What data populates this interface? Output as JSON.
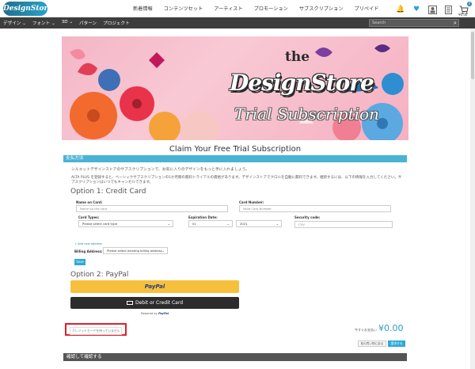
{
  "header": {
    "logo_text": "DesignStore",
    "nav": [
      "新着情報",
      "コンテンツセット",
      "アーティスト",
      "プロモーション",
      "サブスクリプション",
      "プリペイド"
    ],
    "cart_count": "0",
    "cart_price": "¥0.00"
  },
  "subnav": {
    "items": [
      "デザイン ⌄",
      "フォント ⌄",
      "3D ⌄",
      "パターン",
      "プロジェクト"
    ],
    "search_placeholder": "Search"
  },
  "banner": {
    "the": "the",
    "design_store": "DesignStore",
    "trial": "Trial Subscription"
  },
  "page": {
    "title": "Claim Your Free Trial Subscription",
    "section_title": "支払方法",
    "intro1": "シルエットデザインストアのサブスクリプションで、お気に入りのデザインをもっと手に入れましょう。",
    "intro2": "ALTA PLUS を登録すると、ベーシックサブスクリプションの1か月間の無料トライアルの資格があります。デザインストアでクロルを自動に無料できます。継続するには、以下の情報を入力してください。サブスクリプションはいつでもキャンセルできます。"
  },
  "credit_card": {
    "title": "Option 1: Credit Card",
    "name_label": "Name on Card:",
    "name_placeholder": "Name on the card",
    "number_label": "Card Number:",
    "number_placeholder": "Valid Card Number",
    "type_label": "Card Types:",
    "type_value": "Please select card type",
    "exp_label": "Expiration Date:",
    "exp_month": "01",
    "exp_year": "2021",
    "cvv_label": "Security code:",
    "cvv_placeholder": "CVV",
    "add_link": "+ Add new address",
    "billing_label": "Billing Address:",
    "billing_value": "Please select existing billing address",
    "save_label": "Save"
  },
  "paypal": {
    "title": "Option 2: PayPal",
    "paypal_btn": "PayPal",
    "card_btn": "Debit or Credit Card",
    "powered": "Powered by",
    "powered_brand": "PayPal"
  },
  "footer": {
    "no_card": "クレジットカードを持っていません",
    "total_label": "今すぐお支払い",
    "total_value": "¥0.00",
    "back_btn": "前の買い物に戻る",
    "next_btn": "請求する",
    "confirm": "確認して確認する"
  },
  "colors": {
    "accent": "#49b3d6",
    "highlight": "#e0202a",
    "paypal": "#f7c03c",
    "dark": "#3d3d3d"
  }
}
